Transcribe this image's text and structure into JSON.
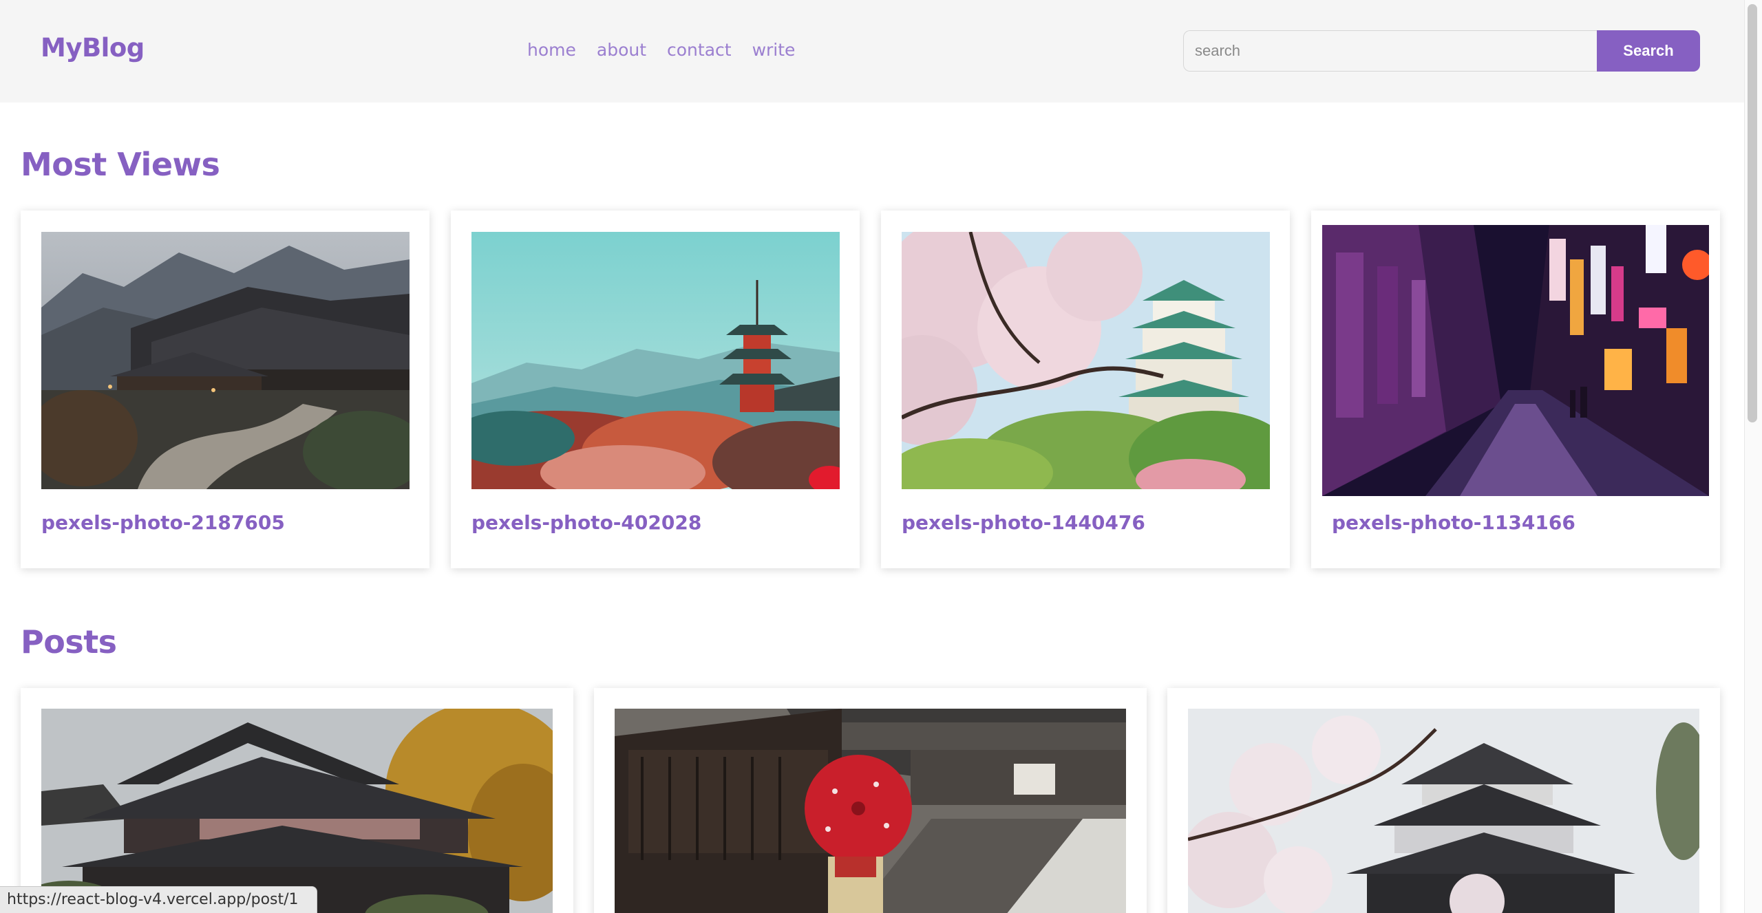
{
  "header": {
    "logo": "MyBlog",
    "nav": [
      "home",
      "about",
      "contact",
      "write"
    ],
    "search_placeholder": "search",
    "search_button": "Search"
  },
  "most_views": {
    "title": "Most Views",
    "cards": [
      {
        "title": "pexels-photo-2187605"
      },
      {
        "title": "pexels-photo-402028"
      },
      {
        "title": "pexels-photo-1440476"
      },
      {
        "title": "pexels-photo-1134166"
      }
    ]
  },
  "posts": {
    "title": "Posts"
  },
  "status_bar": {
    "url": "https://react-blog-v4.vercel.app/post/1"
  },
  "colors": {
    "accent": "#8660c2",
    "nav": "#9b7fd0",
    "header_bg": "#f5f5f5"
  }
}
